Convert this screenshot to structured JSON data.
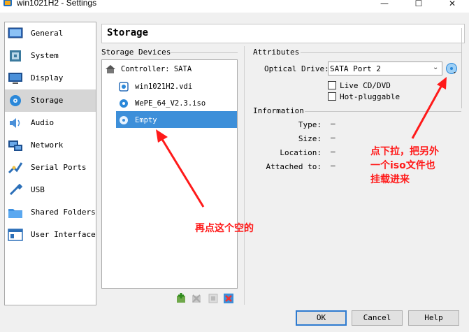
{
  "window": {
    "title": "win1021H2 - Settings",
    "controls": {
      "minimize": "—",
      "maximize": "☐",
      "close": "✕"
    }
  },
  "sidebar": {
    "items": [
      {
        "label": "General",
        "icon": "general-icon"
      },
      {
        "label": "System",
        "icon": "system-icon"
      },
      {
        "label": "Display",
        "icon": "display-icon"
      },
      {
        "label": "Storage",
        "icon": "storage-icon",
        "selected": true
      },
      {
        "label": "Audio",
        "icon": "audio-icon"
      },
      {
        "label": "Network",
        "icon": "network-icon"
      },
      {
        "label": "Serial Ports",
        "icon": "serial-ports-icon"
      },
      {
        "label": "USB",
        "icon": "usb-icon"
      },
      {
        "label": "Shared Folders",
        "icon": "shared-folders-icon"
      },
      {
        "label": "User Interface",
        "icon": "user-interface-icon"
      }
    ]
  },
  "page": {
    "title": "Storage"
  },
  "storage": {
    "section_title": "Storage Devices",
    "controller": "Controller: SATA",
    "devices": [
      {
        "label": "win1021H2.vdi",
        "icon": "hard-disk-icon"
      },
      {
        "label": "WePE_64_V2.3.iso",
        "icon": "optical-disc-icon"
      },
      {
        "label": "Empty",
        "icon": "optical-disc-icon",
        "selected": true
      }
    ],
    "toolbar": [
      "add-controller-icon",
      "remove-controller-icon",
      "add-attachment-icon",
      "remove-attachment-icon"
    ]
  },
  "attributes": {
    "section_title": "Attributes",
    "optical_drive_label": "Optical Drive:",
    "optical_drive_value": "SATA Port 2",
    "live_cd_label": "Live CD/DVD",
    "hot_pluggable_label": "Hot-pluggable",
    "live_cd_checked": false,
    "hot_pluggable_checked": false
  },
  "information": {
    "section_title": "Information",
    "rows": [
      {
        "label": "Type:",
        "value": "—"
      },
      {
        "label": "Size:",
        "value": "—"
      },
      {
        "label": "Location:",
        "value": "—"
      },
      {
        "label": "Attached to:",
        "value": "—"
      }
    ]
  },
  "buttons": {
    "ok": "OK",
    "cancel": "Cancel",
    "help": "Help"
  },
  "annotations": {
    "note_empty": "再点这个空的",
    "note_dropdown_line1": "点下拉，把另外",
    "note_dropdown_line2": "一个iso文件也",
    "note_dropdown_line3": "挂载进来",
    "color": "#ff1a1a"
  },
  "colors": {
    "selection": "#3d8fd9",
    "sidebar_selected": "#d6d6d6"
  }
}
